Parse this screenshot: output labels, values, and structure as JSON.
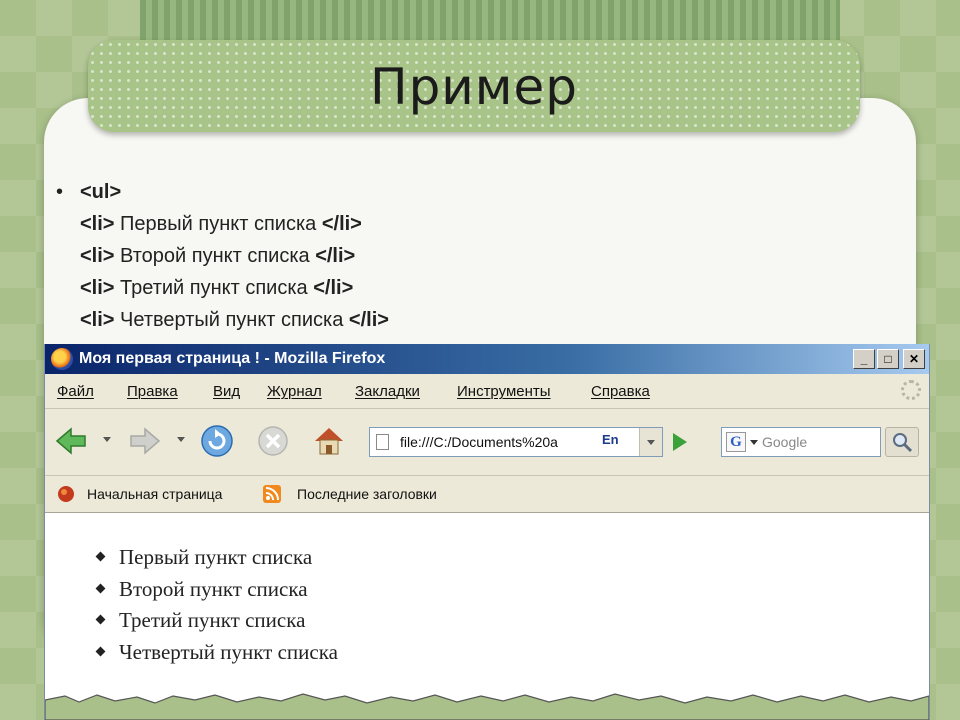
{
  "slide": {
    "title": "Пример",
    "bullet": "•",
    "code_lines": [
      {
        "open": "<ul>",
        "text": "",
        "close": ""
      },
      {
        "open": "<li>",
        "text": " Первый пункт списка ",
        "close": "</li>"
      },
      {
        "open": "<li>",
        "text": " Второй пункт списка ",
        "close": "</li>"
      },
      {
        "open": "<li>",
        "text": " Третий пункт списка ",
        "close": "</li>"
      },
      {
        "open": "<li>",
        "text": " Четвертый пункт списка ",
        "close": "</li>"
      }
    ]
  },
  "browser": {
    "window_title": "Моя первая страница ! - Mozilla Firefox",
    "window_buttons": {
      "minimize": "_",
      "maximize": "□",
      "close": "✕"
    },
    "menu": [
      "Файл",
      "Правка",
      "Вид",
      "Журнал",
      "Закладки",
      "Инструменты",
      "Справка"
    ],
    "address": {
      "value": "file:///C:/Documents%20a",
      "lang_badge": "En"
    },
    "search": {
      "engine_letter": "G",
      "placeholder": "Google"
    },
    "bookmarks": [
      "Начальная страница",
      "Последние заголовки"
    ],
    "page_list": [
      "Первый пункт списка",
      "Второй пункт списка",
      "Третий пункт списка",
      "Четвертый пункт списка"
    ],
    "icons": {
      "app": "firefox-logo-icon",
      "back": "back-arrow-icon",
      "forward": "forward-arrow-icon",
      "reload": "reload-icon",
      "stop": "stop-icon",
      "home": "home-icon",
      "go": "go-arrow-icon",
      "search": "magnifier-icon",
      "bookmark_home": "firefox-bookmark-icon",
      "bookmark_rss": "rss-feed-icon"
    }
  },
  "colors": {
    "background": "#a9c08a",
    "title_bar": "#a8c489",
    "window_title_start": "#0a246a",
    "window_title_end": "#a6caf0",
    "toolbar": "#ece9d8"
  }
}
